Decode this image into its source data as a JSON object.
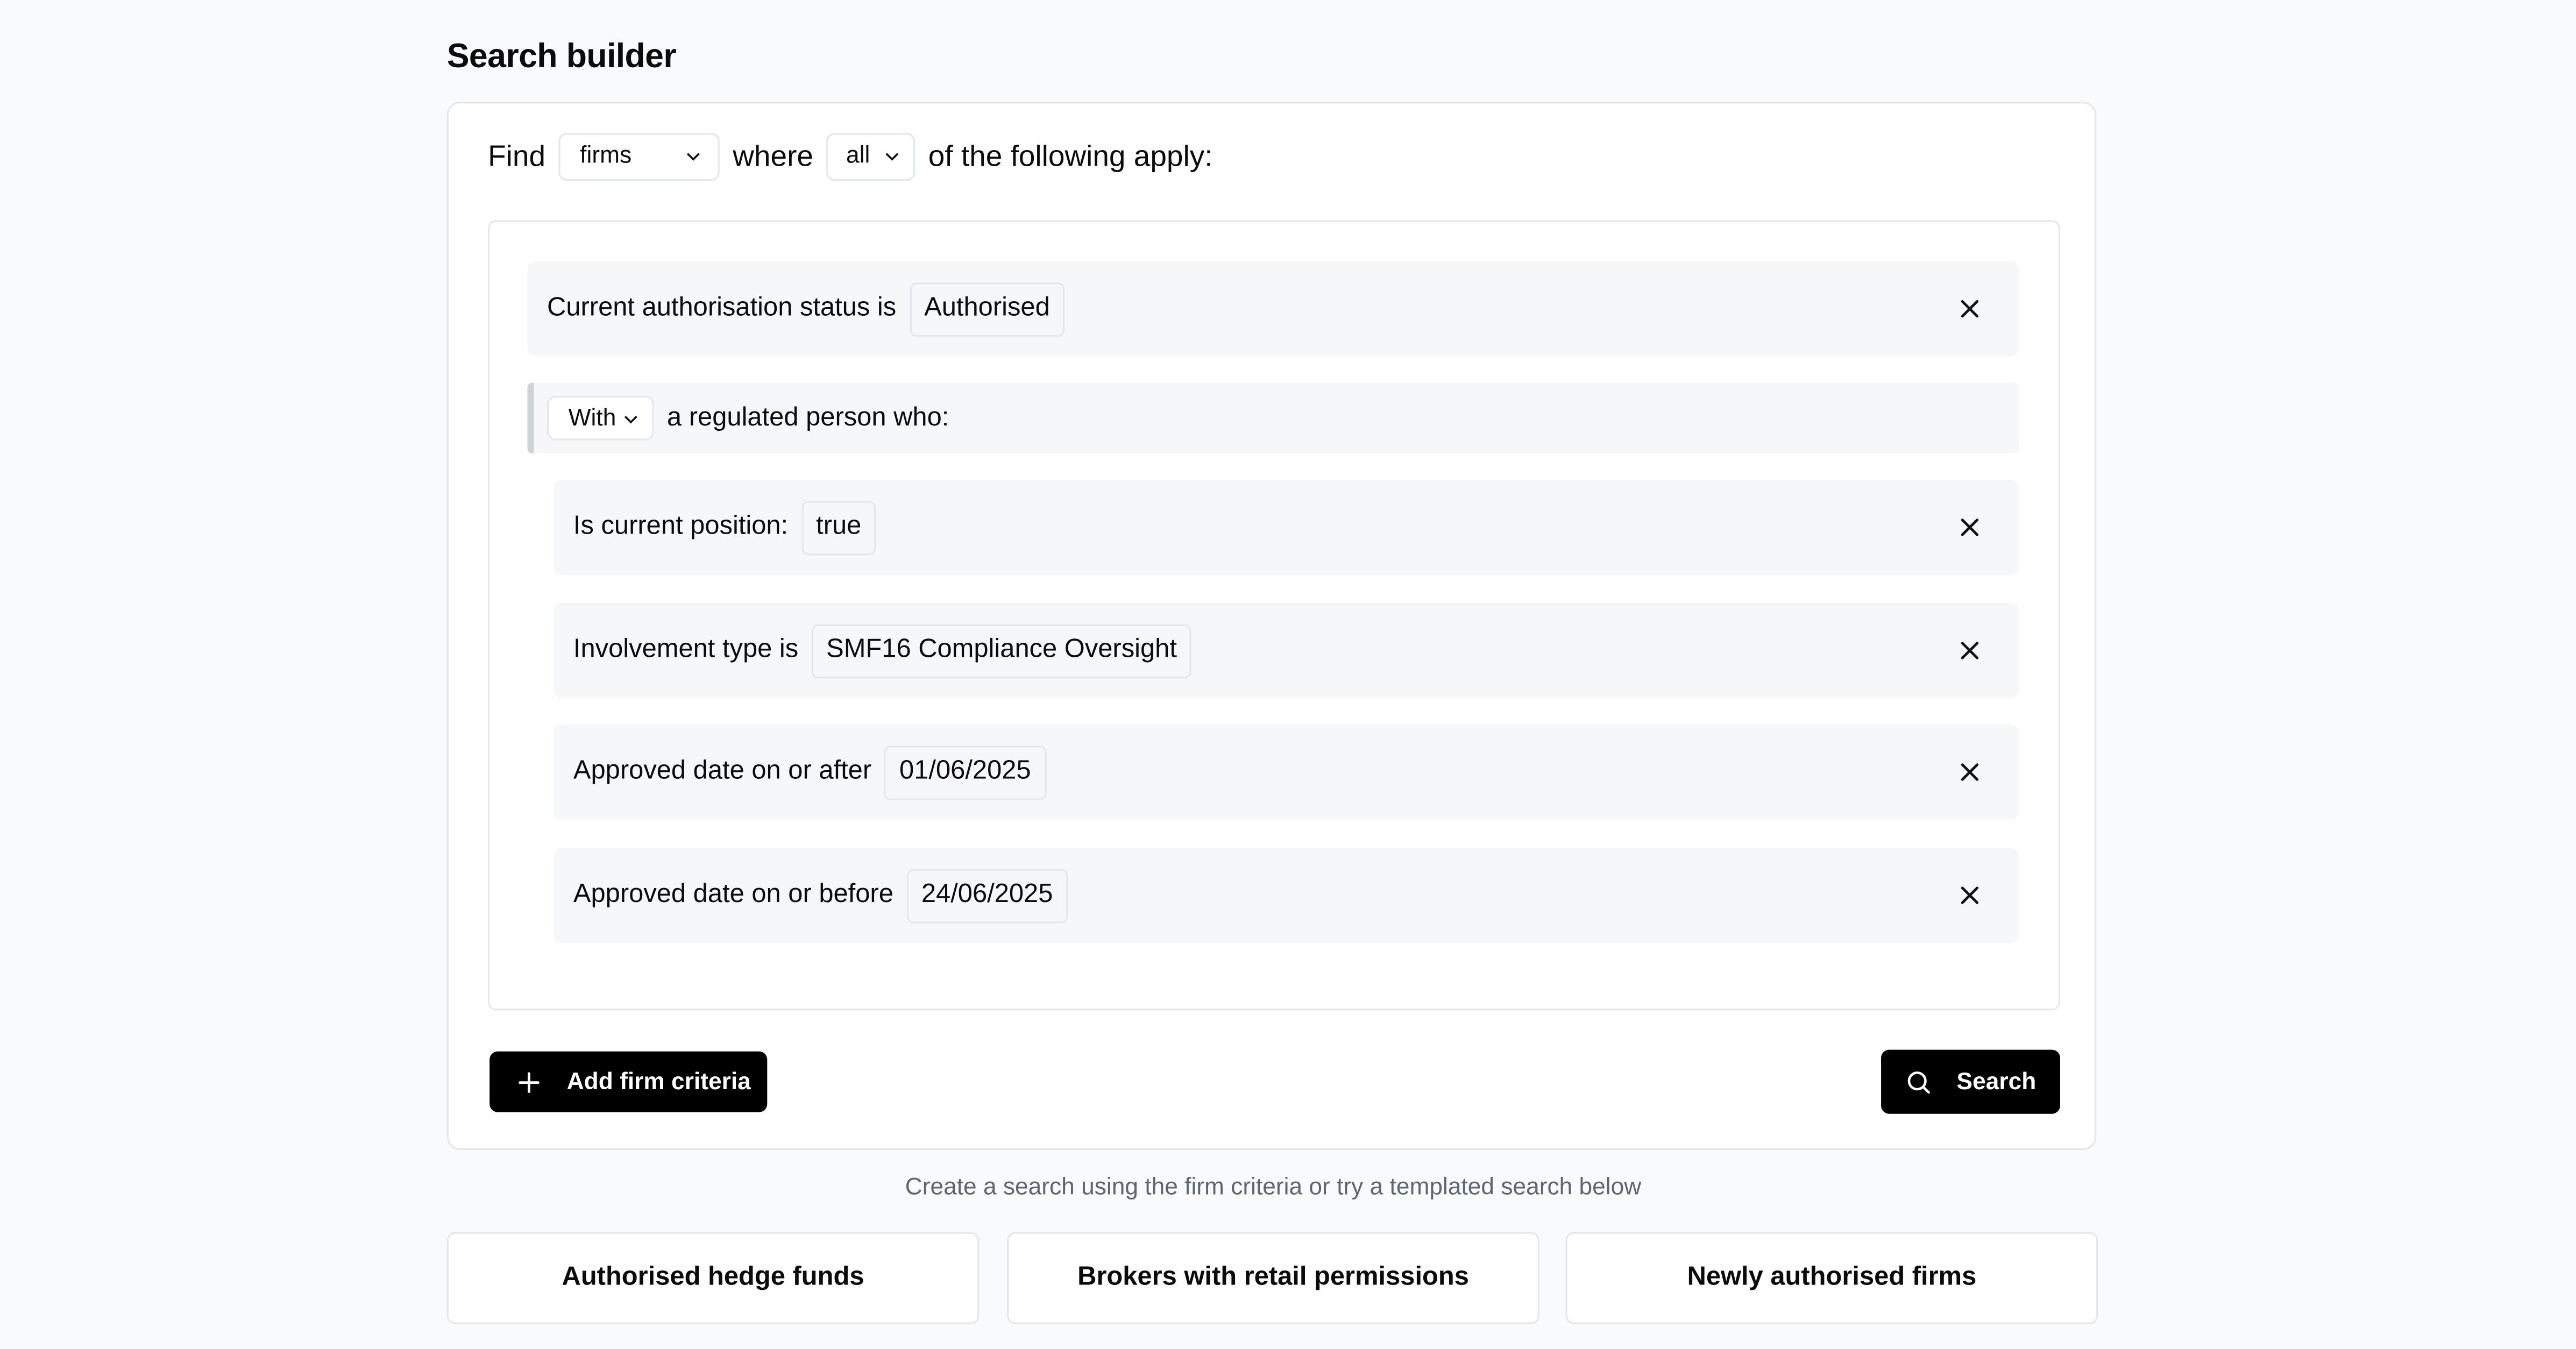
{
  "page": {
    "title": "Search builder"
  },
  "find": {
    "find_label": "Find",
    "entity_value": "firms",
    "where_label": "where",
    "match_value": "all",
    "suffix_label": "of the following apply:"
  },
  "criteria": {
    "authorisation": {
      "label": "Current authorisation status is",
      "value": "Authorised"
    },
    "group": {
      "qualifier_value": "With",
      "label": "a regulated person who:",
      "items": [
        {
          "label": "Is current position:",
          "value": "true"
        },
        {
          "label": "Involvement type is",
          "value": "SMF16 Compliance Oversight"
        },
        {
          "label": "Approved date on or after",
          "value": "01/06/2025"
        },
        {
          "label": "Approved date on or before",
          "value": "24/06/2025"
        }
      ]
    }
  },
  "actions": {
    "add_label": "Add firm criteria",
    "search_label": "Search"
  },
  "hint": "Create a search using the firm criteria or try a templated search below",
  "templates": [
    {
      "label": "Authorised hedge funds"
    },
    {
      "label": "Brokers with retail permissions"
    },
    {
      "label": "Newly authorised firms"
    }
  ],
  "icons": {
    "chevron": "chevron-down-icon",
    "close": "close-icon",
    "plus": "plus-icon",
    "search": "search-icon"
  }
}
